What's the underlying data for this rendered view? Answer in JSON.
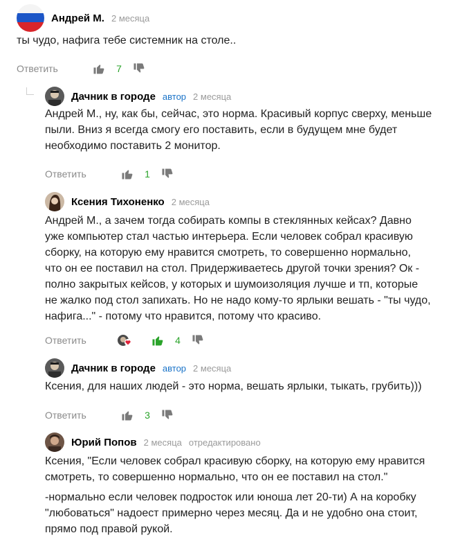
{
  "comments": [
    {
      "author": "Андрей М.",
      "time": "2 месяца",
      "text": "ты чудо, нафига тебе системник на столе..",
      "reply": "Ответить",
      "likes": "7",
      "avatar": "flag-russia-icon"
    },
    {
      "author": "Дачник в городе",
      "badge": "автор",
      "time": "2 месяца",
      "text": "Андрей М., ну, как бы, сейчас, это норма. Красивый корпус сверху, меньше\nпыли. Вниз я всегда смогу его поставить, если в будущем мне будет\nнеобходимо поставить 2 монитор.",
      "reply": "Ответить",
      "likes": "1"
    },
    {
      "author": "Ксения Тихоненко",
      "time": "2 месяца",
      "text": "Андрей М., а зачем тогда собирать компы в стеклянных кейсах? Давно\nуже компьютер стал частью интерьера. Если человек собрал красивую\nсборку, на которую ему нравится смотреть, то совершенно нормально,\nчто он ее поставил на стол. Придерживаетесь другой точки зрения? Ок -\nполно закрытых кейсов, у которых и шумоизоляция лучше и тп, которые\nне жалко под стол запихать. Но не надо кому-то ярлыки вешать - \"ты чудо,\nнафига...\" - потому что нравится, потому что красиво.",
      "reply": "Ответить",
      "likes": "4"
    },
    {
      "author": "Дачник в городе",
      "badge": "автор",
      "time": "2 месяца",
      "text": "Ксения, для наших людей - это норма, вешать ярлыки, тыкать, грубить)))",
      "reply": "Ответить",
      "likes": "3"
    },
    {
      "author": "Юрий Попов",
      "time": "2 месяца",
      "edited": "отредактировано",
      "text": "Ксения, \"Если человек собрал красивую сборку, на которую ему нравится\nсмотреть, то совершенно нормально, что он ее поставил на стол.\"",
      "text2": "-нормально если человек подросток или юноша лет 20-ти) А на коробку\n\"любоваться\" надоест примерно через месяц. Да и не удобно она стоит,\nпрямо под правой рукой."
    }
  ],
  "colors": {
    "like_active": "#2aa32a",
    "count": "#2aa32a",
    "badge": "#1a73c8",
    "muted": "#9a9a9a"
  }
}
